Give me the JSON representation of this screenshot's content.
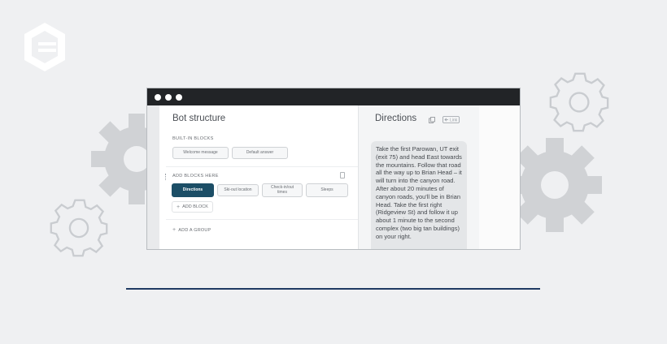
{
  "window": {
    "titlebar_dots": 3
  },
  "left_pane": {
    "title": "Bot structure",
    "built_in_label": "BUILT-IN BLOCKS",
    "built_in_blocks": [
      "Welcome message",
      "Default answer"
    ],
    "add_blocks_label": "ADD BLOCKS HERE",
    "blocks": [
      "Directions",
      "Ski-out location",
      "Check-in/out\ntimes",
      "Sleeps"
    ],
    "active_block": "Directions",
    "add_block_label": "ADD BLOCK",
    "add_group_label": "ADD A GROUP"
  },
  "right_pane": {
    "title": "Directions",
    "link_icon_label": "Link",
    "text": "Take the first Parowan, UT exit (exit 75) and head East towards the mountains. Follow that road all the way up to Brian Head – it will turn into the canyon road. After about 20 minutes of canyon roads, you'll be in Brian Head. Take the first right (Ridgeview St) and follow it up about 1 minute to the second complex (two big tan buildings) on your right."
  },
  "colors": {
    "background": "#eff0f2",
    "titlebar": "#222427",
    "active_chip": "#1c4e66",
    "rule": "#1f3a63",
    "gear_dark": "#d0d2d5",
    "gear_outline": "#c9ccd0"
  },
  "icons": [
    "logo-icon",
    "gear-icon",
    "copy-icon",
    "link-icon",
    "trash-icon",
    "plus-icon"
  ]
}
